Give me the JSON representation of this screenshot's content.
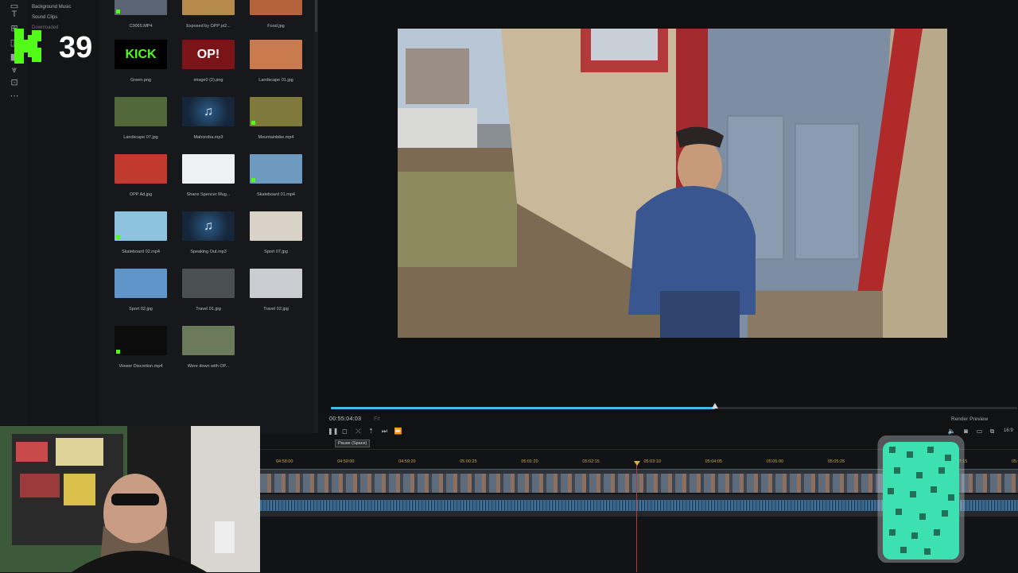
{
  "tree": {
    "items": [
      "Background Music",
      "Sound Clips",
      "Downloaded"
    ]
  },
  "media": {
    "items": [
      {
        "name": "C0065.MP4",
        "kind": "video",
        "color": "#5b6472"
      },
      {
        "name": "Exposed by OPP pt2...",
        "kind": "image",
        "color": "#b58a4a"
      },
      {
        "name": "Food.jpg",
        "kind": "image",
        "color": "#b5633a"
      },
      {
        "name": "Green.png",
        "kind": "image",
        "color": "#000000",
        "label": "KICK"
      },
      {
        "name": "image0 (2).png",
        "kind": "image",
        "color": "#7a1418",
        "label": "OP!"
      },
      {
        "name": "Landscape 01.jpg",
        "kind": "image",
        "color": "#c97a4e"
      },
      {
        "name": "Landscape 07.jpg",
        "kind": "image",
        "color": "#51683a"
      },
      {
        "name": "Mahoroba.mp3",
        "kind": "audio",
        "color": "#1d3550"
      },
      {
        "name": "Mountainbike.mp4",
        "kind": "video",
        "color": "#7f7a3c"
      },
      {
        "name": "OPP Ad.jpg",
        "kind": "image",
        "color": "#c23a2e"
      },
      {
        "name": "Shane Spencer Mug...",
        "kind": "image",
        "color": "#eef0f3"
      },
      {
        "name": "Skateboard 01.mp4",
        "kind": "video",
        "color": "#6f9ac0"
      },
      {
        "name": "Skateboard 02.mp4",
        "kind": "video",
        "color": "#8ec3e0"
      },
      {
        "name": "Speaking Out.mp3",
        "kind": "audio",
        "color": "#1d3550"
      },
      {
        "name": "Sport 07.jpg",
        "kind": "image",
        "color": "#d9d3c7"
      },
      {
        "name": "Sport 02.jpg",
        "kind": "image",
        "color": "#5f95c9"
      },
      {
        "name": "Travel 01.jpg",
        "kind": "image",
        "color": "#4a4f52"
      },
      {
        "name": "Travel 02.jpg",
        "kind": "image",
        "color": "#c9ccd0"
      },
      {
        "name": "Viewer Discretion.mp4",
        "kind": "video",
        "color": "#0c0c0c"
      },
      {
        "name": "Were down with OP...",
        "kind": "image",
        "color": "#6a7a5a"
      }
    ]
  },
  "badge": {
    "number": "39",
    "letter": "K"
  },
  "preview": {
    "timecode": "00:55:04:03",
    "timecode_dim": "Fit",
    "render_preview": "Render Preview",
    "tooltip": "Pause (Space)",
    "progress": 0.56
  },
  "timeline": {
    "ticks": [
      "04:58:00",
      "04:59:00",
      "04:59:20",
      "05:00:25",
      "05:01:20",
      "05:02:15",
      "05:03:10",
      "05:04:05",
      "05:05:00",
      "05:05:25",
      "05:06:20",
      "05:07:15",
      "05:08:10"
    ]
  },
  "colors": {
    "accent": "#49b9e8",
    "kick_green": "#53fc18",
    "playhead": "#b83a3a"
  }
}
